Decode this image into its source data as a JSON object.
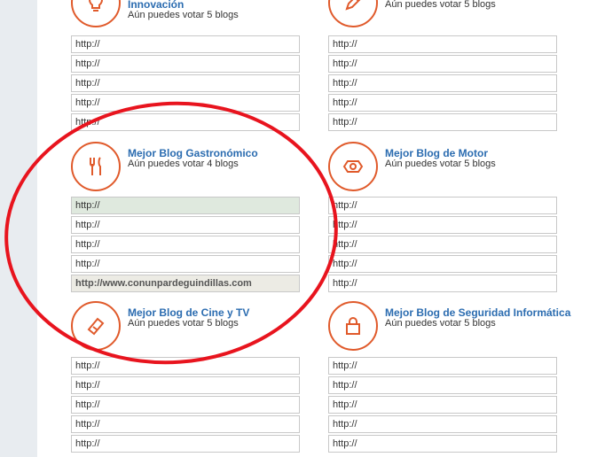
{
  "categories": [
    {
      "key": "innovacion",
      "title": "Innovación",
      "subtitle": "Aún puedes votar 5 blogs",
      "icon": "lightbulb-icon",
      "fields": [
        "http://",
        "http://",
        "http://",
        "http://",
        "http://"
      ]
    },
    {
      "key": "tecnologia",
      "title": "",
      "subtitle": "Aún puedes votar 5 blogs",
      "icon": "pencil-icon",
      "fields": [
        "http://",
        "http://",
        "http://",
        "http://",
        "http://"
      ]
    },
    {
      "key": "gastronomico",
      "title": "Mejor Blog Gastronómico",
      "subtitle": "Aún puedes votar 4 blogs",
      "icon": "fork-knife-icon",
      "fields": [
        "http://",
        "http://",
        "http://",
        "http://",
        "http://www.conunpardeguindillas.com"
      ]
    },
    {
      "key": "motor",
      "title": "Mejor Blog de Motor",
      "subtitle": "Aún puedes votar 5 blogs",
      "icon": "engine-icon",
      "fields": [
        "http://",
        "http://",
        "http://",
        "http://",
        "http://"
      ]
    },
    {
      "key": "cine",
      "title": "Mejor Blog de Cine y TV",
      "subtitle": "Aún puedes votar 5 blogs",
      "icon": "ticket-icon",
      "fields": [
        "http://",
        "http://",
        "http://",
        "http://",
        "http://"
      ]
    },
    {
      "key": "seguridad",
      "title": "Mejor Blog de Seguridad Informática",
      "subtitle": "Aún puedes votar 5 blogs",
      "icon": "lock-icon",
      "fields": [
        "http://",
        "http://",
        "http://",
        "http://",
        "http://"
      ]
    }
  ],
  "colors": {
    "accent": "#e05a2b",
    "title_blue": "#2b6cb0",
    "annotation_red": "#e8141e"
  }
}
